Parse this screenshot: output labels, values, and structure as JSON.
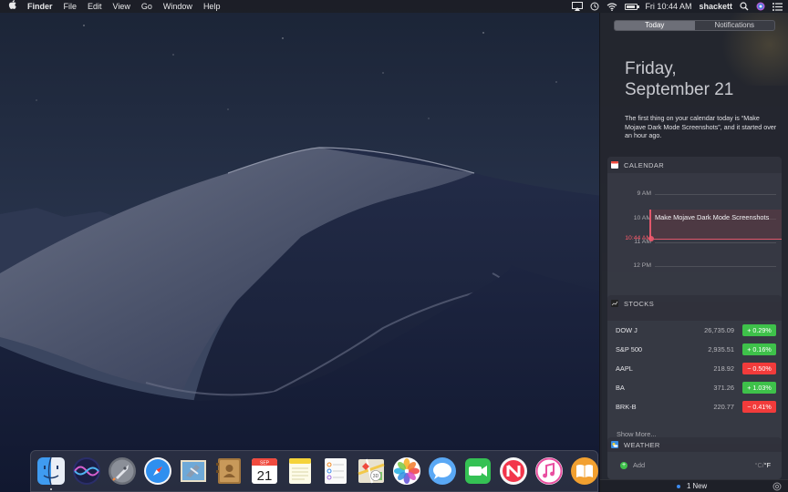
{
  "menubar": {
    "apple_glyph": "",
    "app_name": "Finder",
    "menus": [
      "File",
      "Edit",
      "View",
      "Go",
      "Window",
      "Help"
    ],
    "clock": "Fri 10:44 AM",
    "user": "shackett",
    "battery_level": 0.85,
    "status_icons": [
      "airplay-icon",
      "time-machine-icon",
      "wifi-icon",
      "battery-icon",
      "spotlight-icon",
      "siri-icon",
      "notification-center-icon"
    ]
  },
  "notification_center": {
    "tabs": [
      {
        "label": "Today",
        "active": true
      },
      {
        "label": "Notifications",
        "active": false
      }
    ],
    "date": {
      "line1": "Friday,",
      "line2": "September 21"
    },
    "summary": "The first thing on your calendar today is “Make Mojave Dark Mode Screenshots”, and it started over an hour ago.",
    "calendar": {
      "header": "CALENDAR",
      "times": [
        "9 AM",
        "10 AM",
        "11 AM",
        "12 PM"
      ],
      "now_time": "10:44 AM",
      "event_title": "Make Mojave Dark Mode Screenshots",
      "accent": "#e2576b"
    },
    "stocks": {
      "header": "STOCKS",
      "rows": [
        {
          "symbol": "DOW J",
          "price": "26,735.09",
          "change": "+ 0.29%",
          "direction": "up"
        },
        {
          "symbol": "S&P 500",
          "price": "2,935.51",
          "change": "+ 0.16%",
          "direction": "up"
        },
        {
          "symbol": "AAPL",
          "price": "218.92",
          "change": "− 0.50%",
          "direction": "down"
        },
        {
          "symbol": "BA",
          "price": "371.26",
          "change": "+ 1.03%",
          "direction": "up"
        },
        {
          "symbol": "BRK-B",
          "price": "220.77",
          "change": "− 0.41%",
          "direction": "down"
        }
      ],
      "show_more": "Show More...",
      "up_color": "#3ec14a",
      "down_color": "#f23b3b"
    },
    "weather": {
      "header": "WEATHER",
      "add_label": "Add",
      "unit_c": "°C",
      "unit_separator": "/",
      "unit_f": "°F"
    },
    "bottom": {
      "new_label": "1 New"
    }
  },
  "dock": {
    "apps": [
      {
        "name": "Finder",
        "icon": "finder-icon",
        "running": true
      },
      {
        "name": "Siri",
        "icon": "siri-icon",
        "running": false
      },
      {
        "name": "Launchpad",
        "icon": "launchpad-icon",
        "running": false
      },
      {
        "name": "Safari",
        "icon": "safari-icon",
        "running": false
      },
      {
        "name": "Mail",
        "icon": "mail-icon",
        "running": false
      },
      {
        "name": "Contacts",
        "icon": "contacts-icon",
        "running": false
      },
      {
        "name": "Calendar",
        "icon": "calendar-icon",
        "running": false,
        "month": "SEP",
        "day": "21"
      },
      {
        "name": "Notes",
        "icon": "notes-icon",
        "running": false
      },
      {
        "name": "Reminders",
        "icon": "reminders-icon",
        "running": false
      },
      {
        "name": "Maps",
        "icon": "maps-icon",
        "running": false
      },
      {
        "name": "Photos",
        "icon": "photos-icon",
        "running": false
      },
      {
        "name": "Messages",
        "icon": "messages-icon",
        "running": false
      },
      {
        "name": "FaceTime",
        "icon": "facetime-icon",
        "running": false
      },
      {
        "name": "News",
        "icon": "news-icon",
        "running": false
      },
      {
        "name": "iTunes",
        "icon": "itunes-icon",
        "running": false
      },
      {
        "name": "Books",
        "icon": "books-icon",
        "running": false
      }
    ]
  }
}
